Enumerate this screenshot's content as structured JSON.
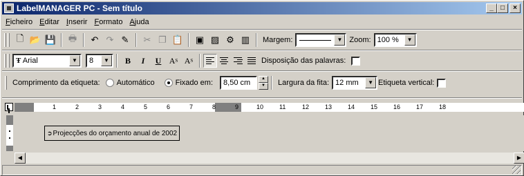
{
  "window": {
    "title": "LabelMANAGER PC - Sem título"
  },
  "menu": [
    {
      "label": "Ficheiro"
    },
    {
      "label": "Editar"
    },
    {
      "label": "Inserir"
    },
    {
      "label": "Formato"
    },
    {
      "label": "Ajuda"
    }
  ],
  "toolbar1": {
    "margem_label": "Margem:",
    "zoom_label": "Zoom:",
    "zoom_value": "100 %",
    "icons": [
      "new-icon",
      "open-icon",
      "save-icon",
      "print-icon",
      "undo-icon",
      "redo-icon",
      "edit-icon",
      "cut-icon",
      "copy-icon",
      "paste-icon",
      "clipart-icon",
      "image-icon",
      "symbol-icon",
      "barcode-icon"
    ]
  },
  "toolbar2": {
    "font_name": "Arial",
    "font_size": "8",
    "bold": "B",
    "italic": "I",
    "underline": "U",
    "superscript": "A",
    "superscript_mark": "S",
    "subscript": "A",
    "subscript_mark": "S",
    "word_layout_label": "Disposição das palavras:"
  },
  "toolbar3": {
    "label_length": "Comprimento da etiqueta:",
    "automatic": "Automático",
    "fixed": "Fixado em:",
    "fixed_value": "8,50 cm",
    "tape_width_label": "Largura da fita:",
    "tape_width_value": "12 mm",
    "vertical_label": "Etiqueta vertical:"
  },
  "ruler": {
    "ticks": [
      "1",
      "2",
      "3",
      "4",
      "5",
      "6",
      "7",
      "8",
      "9",
      "10",
      "11",
      "12",
      "13",
      "14",
      "15",
      "16",
      "17",
      "18"
    ]
  },
  "label": {
    "text": "Projecções do orçamento anual de 2002"
  }
}
